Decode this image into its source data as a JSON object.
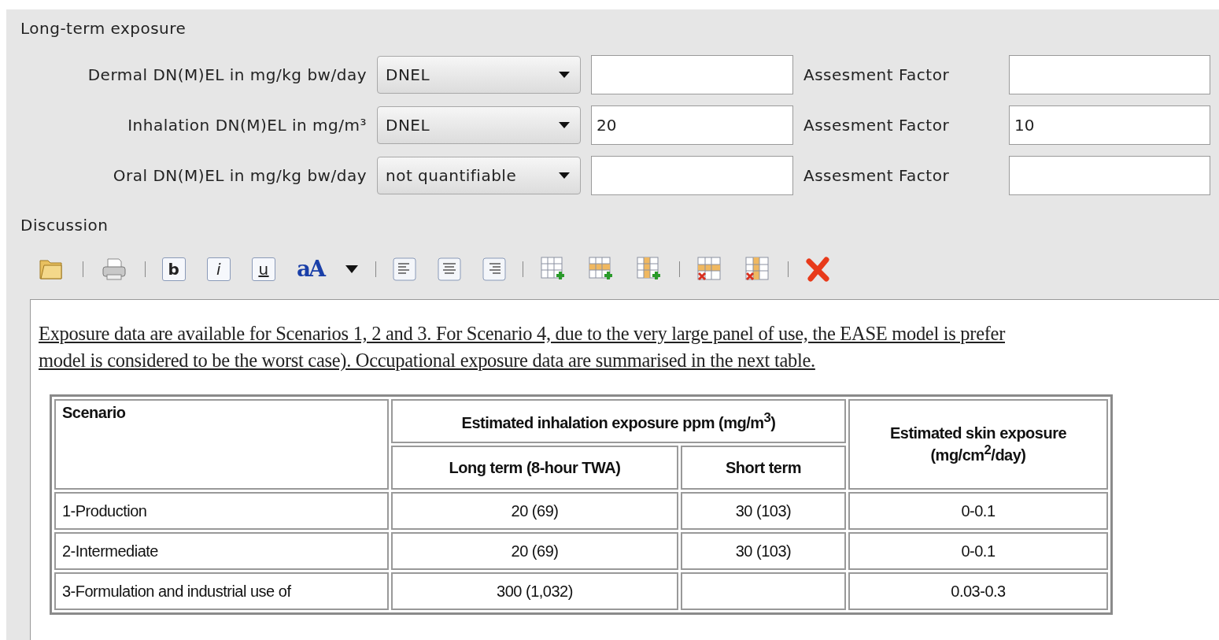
{
  "section_title": "Long-term exposure",
  "rows": [
    {
      "label": "Dermal DN(M)EL in mg/kg bw/day",
      "select": "DNEL",
      "factor_label": "Assesment Factor"
    },
    {
      "label": "Inhalation DN(M)EL in mg/m³",
      "select": "DNEL",
      "value": "20",
      "factor_label": "Assesment Factor",
      "factor": "10"
    },
    {
      "label": "Oral DN(M)EL in mg/kg bw/day",
      "select": "not quantifiable",
      "factor_label": "Assesment Factor"
    }
  ],
  "discussion_label": "Discussion",
  "toolbar": [
    {
      "kind": "open"
    },
    {
      "kind": "sep"
    },
    {
      "kind": "print"
    },
    {
      "kind": "sep"
    },
    {
      "kind": "bold",
      "glyph": "b"
    },
    {
      "kind": "italic",
      "glyph": "i"
    },
    {
      "kind": "underline",
      "glyph": "u"
    },
    {
      "kind": "font",
      "glyph": "aA"
    },
    {
      "kind": "caret"
    },
    {
      "kind": "sep"
    },
    {
      "kind": "align-left"
    },
    {
      "kind": "align-center"
    },
    {
      "kind": "align-right"
    },
    {
      "kind": "sep"
    },
    {
      "kind": "add-table"
    },
    {
      "kind": "add-row"
    },
    {
      "kind": "add-column"
    },
    {
      "kind": "sep"
    },
    {
      "kind": "delete-row"
    },
    {
      "kind": "delete-column"
    },
    {
      "kind": "sep"
    },
    {
      "kind": "delete"
    }
  ],
  "paragraph": [
    "Exposure data are available for Scenarios 1, 2 and 3. For Scenario 4, due to the very large panel of use, the EASE model is prefer",
    "model is considered to be the worst case). Occupational exposure data are summarised in the next table."
  ],
  "table": {
    "headers": {
      "scenario": "Scenario",
      "inhalation": "Estimated inhalation exposure ppm (mg/m$^{3}$)",
      "long_term": "Long term (8-hour TWA)",
      "short_term": "Short term",
      "skin": "Estimated skin exposure (mg/cm$^{2}$/day)"
    },
    "rows": [
      [
        "1-Production",
        "20 (69)",
        "30 (103)",
        "0-0.1"
      ],
      [
        "2-Intermediate",
        "20 (69)",
        "30 (103)",
        "0-0.1"
      ],
      [
        "3-Formulation and industrial use of",
        "300 (1,032)",
        "",
        "0.03-0.3"
      ]
    ]
  }
}
